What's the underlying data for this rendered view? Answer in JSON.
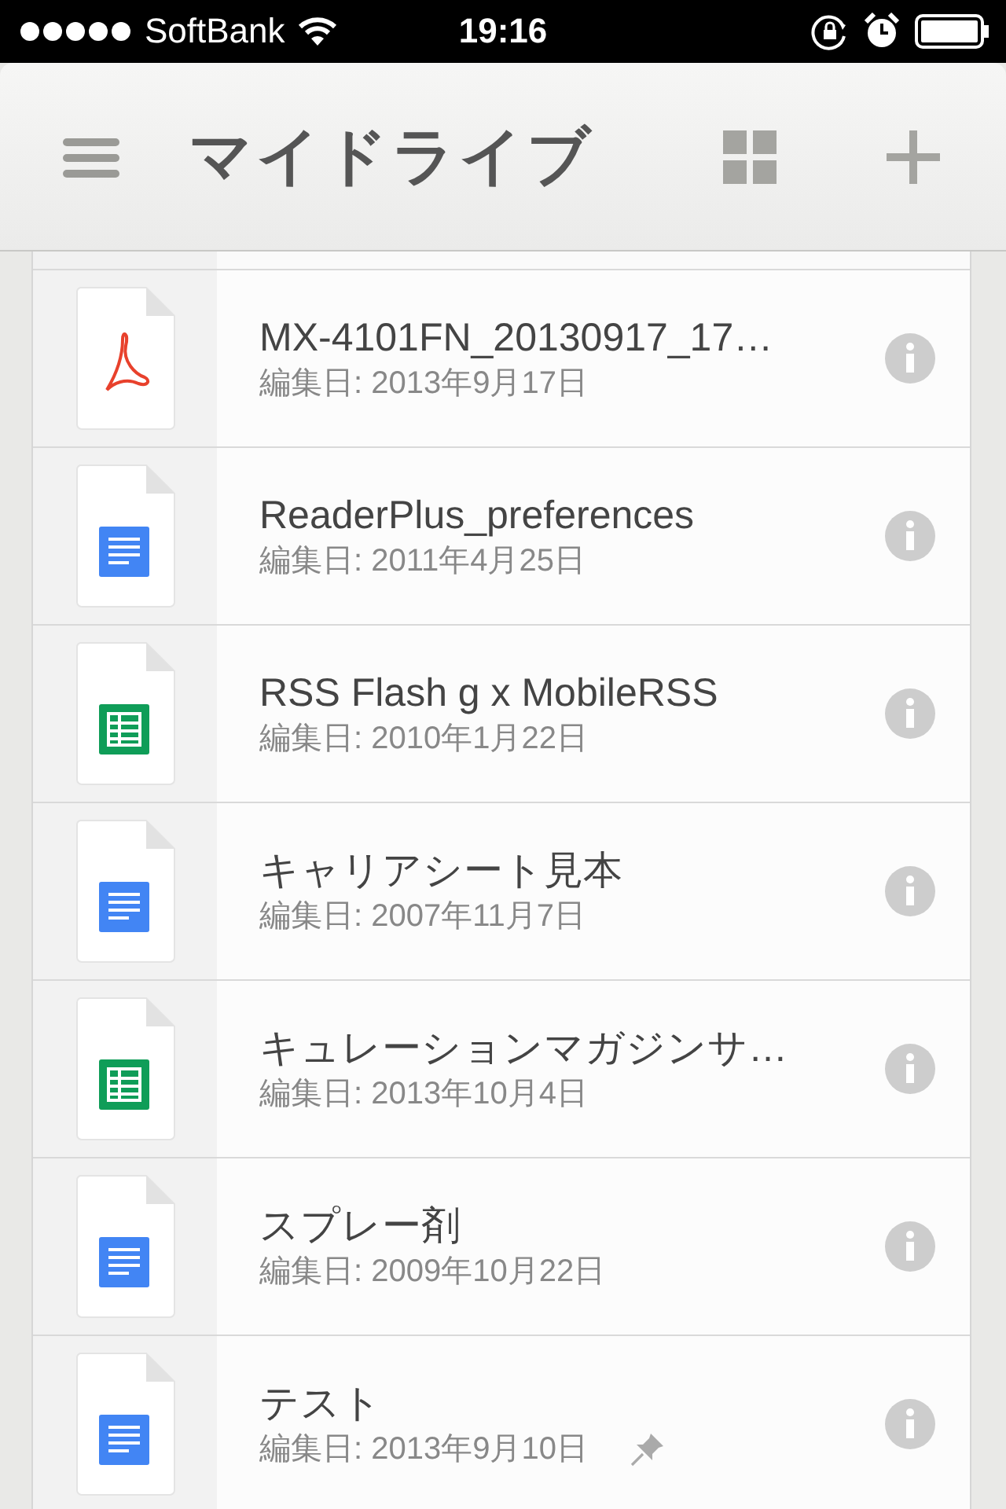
{
  "status_bar": {
    "carrier": "SoftBank",
    "time": "19:16"
  },
  "header": {
    "title": "マイドライブ"
  },
  "files": [
    {
      "kind": "pdf",
      "name": "MX-4101FN_20130917_17…",
      "modified": "編集日: 2013年9月17日",
      "pinned": false
    },
    {
      "kind": "doc",
      "name": "ReaderPlus_preferences",
      "modified": "編集日: 2011年4月25日",
      "pinned": false
    },
    {
      "kind": "sheet",
      "name": "RSS Flash g x MobileRSS",
      "modified": "編集日: 2010年1月22日",
      "pinned": false
    },
    {
      "kind": "doc",
      "name": "キャリアシート見本",
      "modified": "編集日: 2007年11月7日",
      "pinned": false
    },
    {
      "kind": "sheet",
      "name": "キュレーションマガジンサ…",
      "modified": "編集日: 2013年10月4日",
      "pinned": false
    },
    {
      "kind": "doc",
      "name": "スプレー剤",
      "modified": "編集日: 2009年10月22日",
      "pinned": false
    },
    {
      "kind": "doc",
      "name": "テスト",
      "modified": "編集日: 2013年9月10日",
      "pinned": true
    }
  ]
}
